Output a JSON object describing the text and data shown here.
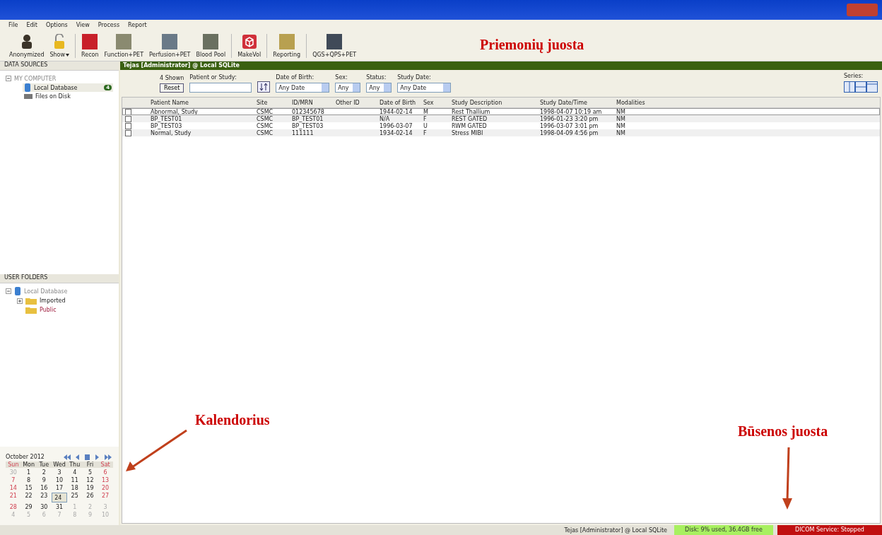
{
  "menu": [
    "File",
    "Edit",
    "Options",
    "View",
    "Process",
    "Report"
  ],
  "toolbar": [
    {
      "label": "Anonymized",
      "kind": "person",
      "color": "#3a3328"
    },
    {
      "label": "Show",
      "kind": "lock",
      "color": "#e8b820",
      "caret": true
    },
    {
      "label": "Recon",
      "kind": "tile",
      "color": "#c8202a"
    },
    {
      "label": "Function+PET",
      "kind": "tile",
      "color": "#8a8a70"
    },
    {
      "label": "Perfusion+PET",
      "kind": "tile",
      "color": "#6a7a88"
    },
    {
      "label": "Blood Pool",
      "kind": "tile",
      "color": "#6a7060"
    },
    {
      "label": "MakeVol",
      "kind": "cube",
      "color": "#d0303a"
    },
    {
      "label": "Reporting",
      "kind": "tile",
      "color": "#b8a050"
    },
    {
      "label": "QGS+QPS+PET",
      "kind": "tile",
      "color": "#404a58"
    }
  ],
  "annotations": [
    {
      "text": "Priemonių juosta",
      "kind": "plain"
    },
    {
      "text": "Kalendorius",
      "kind": "arrow-left"
    },
    {
      "text": "Būsenos juosta",
      "kind": "arrow-down"
    }
  ],
  "data_sources": {
    "title": "DATA SOURCES",
    "root": "MY COMPUTER",
    "items": [
      {
        "label": "Local Database",
        "badge": "4",
        "selected": true
      },
      {
        "label": "Files on Disk",
        "selected": false
      }
    ]
  },
  "user_folders": {
    "title": "USER FOLDERS",
    "root": "Local Database",
    "children": [
      {
        "label": "Imported",
        "expandable": true
      },
      {
        "label": "Public",
        "expandable": false
      }
    ]
  },
  "calendar": {
    "month": "October 2012",
    "weekdays": [
      "Sun",
      "Mon",
      "Tue",
      "Wed",
      "Thu",
      "Fri",
      "Sat"
    ],
    "weeks": [
      [
        {
          "d": "30",
          "muted": true,
          "selected": false
        },
        {
          "d": "1",
          "muted": false,
          "selected": false
        },
        {
          "d": "2",
          "muted": false,
          "selected": false
        },
        {
          "d": "3",
          "muted": false,
          "selected": false
        },
        {
          "d": "4",
          "muted": false,
          "selected": false
        },
        {
          "d": "5",
          "muted": false,
          "selected": false
        },
        {
          "d": "6",
          "muted": false,
          "selected": false
        }
      ],
      [
        {
          "d": "7",
          "muted": false,
          "selected": false
        },
        {
          "d": "8",
          "muted": false,
          "selected": false
        },
        {
          "d": "9",
          "muted": false,
          "selected": false
        },
        {
          "d": "10",
          "muted": false,
          "selected": false
        },
        {
          "d": "11",
          "muted": false,
          "selected": false
        },
        {
          "d": "12",
          "muted": false,
          "selected": false
        },
        {
          "d": "13",
          "muted": false,
          "selected": false
        }
      ],
      [
        {
          "d": "14",
          "muted": false,
          "selected": false
        },
        {
          "d": "15",
          "muted": false,
          "selected": false
        },
        {
          "d": "16",
          "muted": false,
          "selected": false
        },
        {
          "d": "17",
          "muted": false,
          "selected": false
        },
        {
          "d": "18",
          "muted": false,
          "selected": false
        },
        {
          "d": "19",
          "muted": false,
          "selected": false
        },
        {
          "d": "20",
          "muted": false,
          "selected": false
        }
      ],
      [
        {
          "d": "21",
          "muted": false,
          "selected": false
        },
        {
          "d": "22",
          "muted": false,
          "selected": false
        },
        {
          "d": "23",
          "muted": false,
          "selected": false
        },
        {
          "d": "24",
          "muted": false,
          "selected": true
        },
        {
          "d": "25",
          "muted": false,
          "selected": false
        },
        {
          "d": "26",
          "muted": false,
          "selected": false
        },
        {
          "d": "27",
          "muted": false,
          "selected": false
        }
      ],
      [
        {
          "d": "28",
          "muted": false,
          "selected": false
        },
        {
          "d": "29",
          "muted": false,
          "selected": false
        },
        {
          "d": "30",
          "muted": false,
          "selected": false
        },
        {
          "d": "31",
          "muted": false,
          "selected": false
        },
        {
          "d": "1",
          "muted": true,
          "selected": false
        },
        {
          "d": "2",
          "muted": true,
          "selected": false
        },
        {
          "d": "3",
          "muted": true,
          "selected": false
        }
      ],
      [
        {
          "d": "4",
          "muted": true,
          "selected": false
        },
        {
          "d": "5",
          "muted": true,
          "selected": false
        },
        {
          "d": "6",
          "muted": true,
          "selected": false
        },
        {
          "d": "7",
          "muted": true,
          "selected": false
        },
        {
          "d": "8",
          "muted": true,
          "selected": false
        },
        {
          "d": "9",
          "muted": true,
          "selected": false
        },
        {
          "d": "10",
          "muted": true,
          "selected": false
        }
      ]
    ]
  },
  "header": "Tejas [Administrator] @ Local SQLite",
  "filters": {
    "shown": "4 Shown",
    "reset": "Reset",
    "search_label": "Patient or Study:",
    "dob_label": "Date of Birth:",
    "dob": "Any Date",
    "sex_label": "Sex:",
    "sex": "Any",
    "status_label": "Status:",
    "status": "Any",
    "study_date_label": "Study Date:",
    "study_date": "Any Date",
    "series_label": "Series:"
  },
  "table": {
    "columns": [
      "Patient Name",
      "Site",
      "ID/MRN",
      "Other ID",
      "Date of Birth",
      "Sex",
      "Study Description",
      "Study Date/Time",
      "Modalities"
    ],
    "rows": [
      {
        "selected": true,
        "cells": [
          "Abnormal, Study",
          "CSMC",
          "012345678",
          "",
          "1944-02-14",
          "M",
          "Rest Thallium",
          "1998-04-07 10:19 am",
          "NM"
        ]
      },
      {
        "selected": false,
        "cells": [
          "BP_TEST01",
          "CSMC",
          "BP_TEST01",
          "",
          "N/A",
          "F",
          "REST GATED",
          "1996-01-23 3:20 pm",
          "NM"
        ]
      },
      {
        "selected": false,
        "cells": [
          "BP_TEST03",
          "CSMC",
          "BP_TEST03",
          "",
          "1996-03-07",
          "U",
          "RWM GATED",
          "1996-03-07 3:01 pm",
          "NM"
        ]
      },
      {
        "selected": false,
        "cells": [
          "Normal, Study",
          "CSMC",
          "111111",
          "",
          "1934-02-14",
          "F",
          "Stress MIBI",
          "1998-04-09 4:56 pm",
          "NM"
        ]
      }
    ]
  },
  "status_bar": {
    "user": "Tejas [Administrator] @ Local SQLite",
    "disk": "Disk: 9% used, 36.4GB free",
    "dicom": "DICOM Service: Stopped",
    "dicom_on": false
  }
}
